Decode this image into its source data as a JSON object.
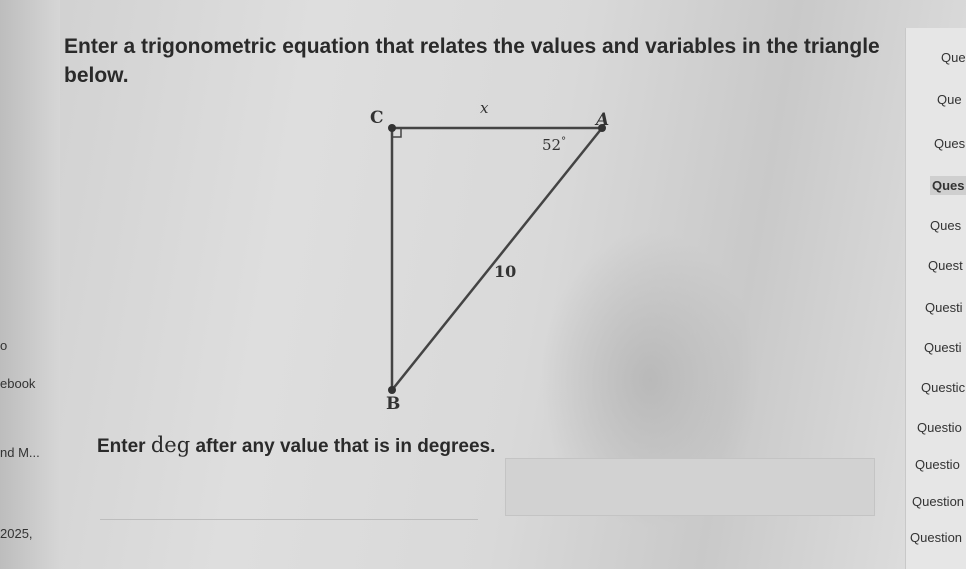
{
  "question": {
    "line1": "Enter a trigonometric equation that relates the values and variables in the triangle",
    "line2": "below."
  },
  "diagram": {
    "vertex_c": "C",
    "vertex_a": "A",
    "vertex_b": "B",
    "side_top": "x",
    "angle_a": "52",
    "angle_unit": "°",
    "hypotenuse": "10"
  },
  "hint": {
    "prefix": "Enter ",
    "keyword": "deg",
    "suffix": " after any value that is in degrees."
  },
  "left_nav": {
    "items": [
      "o",
      "ebook",
      "nd M...",
      "2025,"
    ]
  },
  "right_panel": {
    "items": [
      "Que",
      "Que",
      "Ques",
      "Ques",
      "Ques",
      "Quest",
      "Questi",
      "Questi",
      "Questic",
      "Questio",
      "Questio",
      "Question",
      "Question"
    ]
  },
  "colors": {
    "background": "#d9d9d9",
    "text": "#2a2a2a",
    "line": "#444444"
  }
}
